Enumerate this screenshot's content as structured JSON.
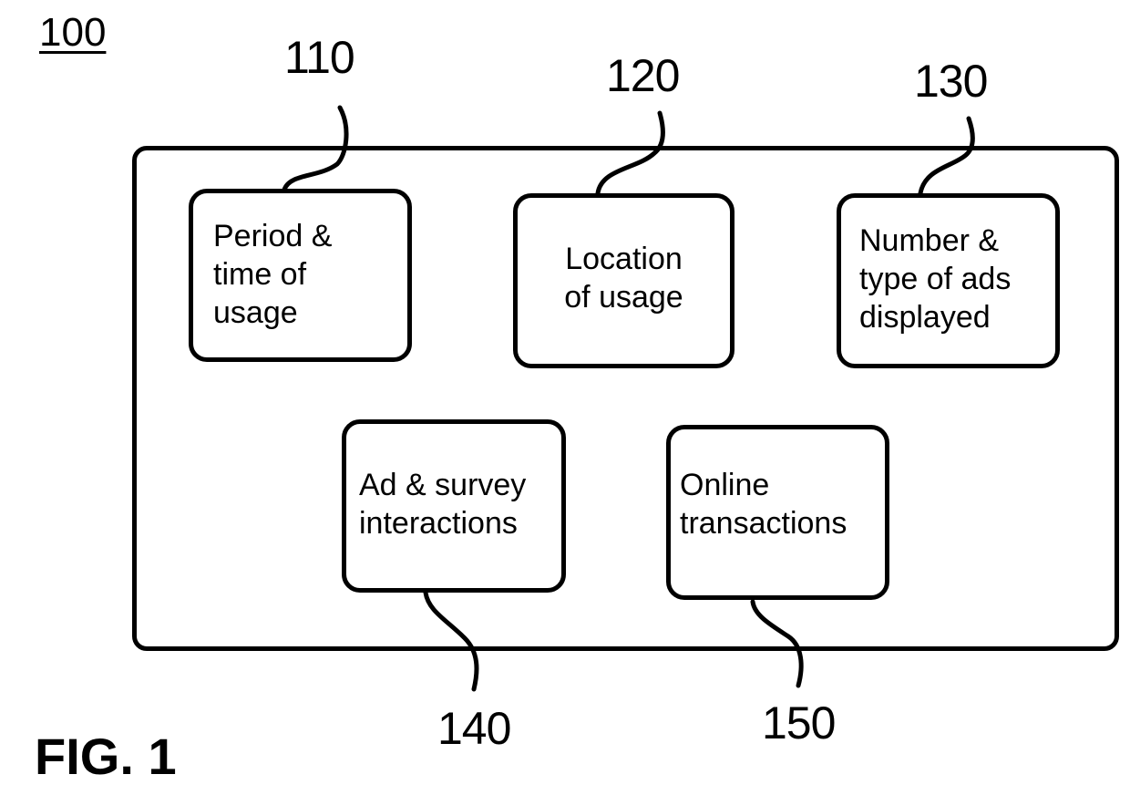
{
  "figure": {
    "number_label": "100",
    "title": "FIG. 1"
  },
  "components": [
    {
      "ref": "110",
      "text": "Period &\ntime of\nusage"
    },
    {
      "ref": "120",
      "text": "Location\nof usage"
    },
    {
      "ref": "130",
      "text": "Number &\ntype of ads\ndisplayed"
    },
    {
      "ref": "140",
      "text": "Ad & survey\ninteractions"
    },
    {
      "ref": "150",
      "text": "Online\ntransactions"
    }
  ]
}
